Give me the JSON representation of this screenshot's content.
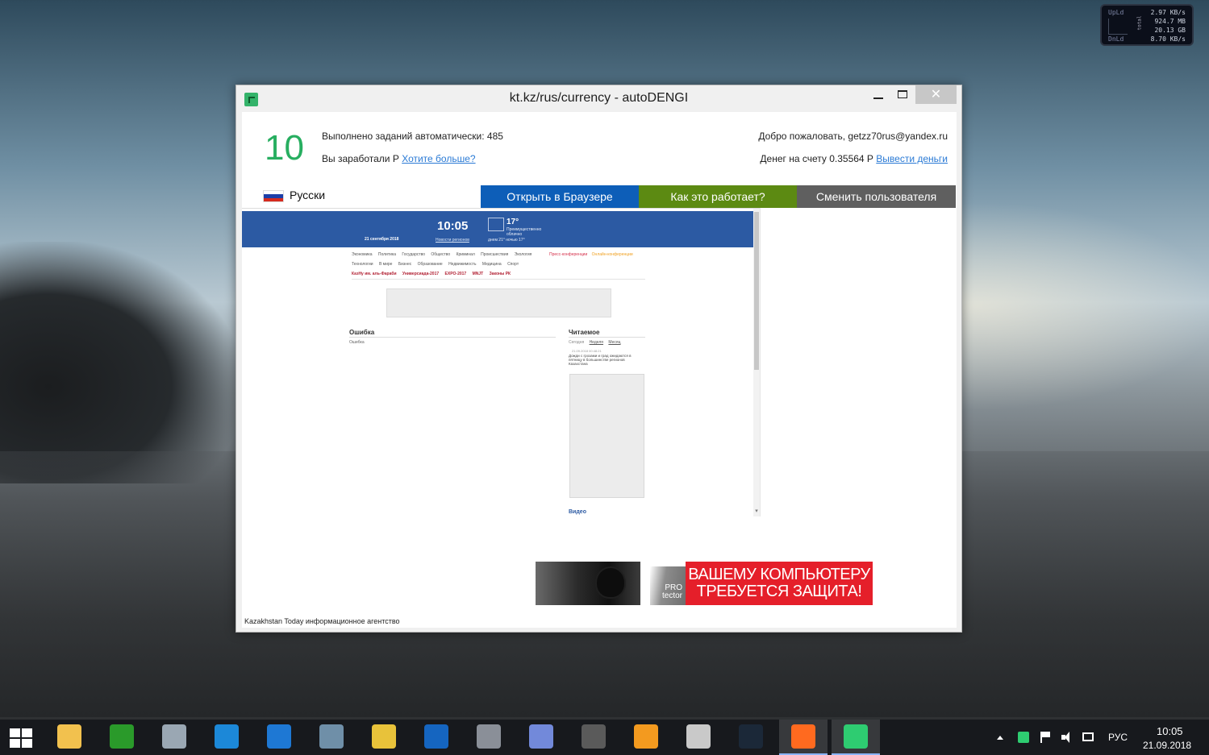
{
  "network_meter": {
    "upload_label": "UpLd",
    "download_label": "DnLd",
    "total_label": "total",
    "upload_rate": "2.97 KB/s",
    "total_upload": "924.7 MB",
    "total_download": "20.13 GB",
    "download_rate": "8.70 KB/s"
  },
  "window": {
    "title": "kt.kz/rus/currency - autoDENGI",
    "minimize": "—",
    "close": "✕"
  },
  "app": {
    "counter": "10",
    "tasks_done": "Выполнено заданий автоматически: 485",
    "earned_label": "Вы заработали  Р",
    "want_more_link": "Хотите больше?",
    "welcome": "Добро пожаловать, getzz70rus@yandex.ru",
    "balance_label": "Денег на счету 0.35564 Р",
    "withdraw_link": "Вывести деньги",
    "language": "Русски",
    "flag_colors": [
      "#ffffff",
      "#1c3fa8",
      "#d52b1e"
    ],
    "buttons": {
      "open_browser": "Открыть в Браузере",
      "how_it_works": "Как это работает?",
      "switch_user": "Сменить пользователя"
    },
    "button_colors": {
      "open_browser": "#0d5eb8",
      "how_it_works": "#5c8a12",
      "switch_user": "#5f5f5f"
    },
    "accent_color": "#27ae60",
    "footer": "Kazakhstan Today информационное агентство"
  },
  "site": {
    "time": "10:05",
    "date": "21 сентября 2018",
    "regional_news": "Новости регионов",
    "temperature": "17°",
    "weather_desc": "Преимущественно облачно",
    "day_night": "днем 21°   ночью 17°",
    "menu_row1": [
      "Экономика",
      "Политика",
      "Государство",
      "Общество",
      "Криминал",
      "Происшествия",
      "Экология"
    ],
    "menu_row2": [
      "Технологии",
      "В мире",
      "Бизнес",
      "Образование",
      "Недвижимость",
      "Медицина",
      "Спорт"
    ],
    "menu_red": [
      "КазНу им. аль-Фараби",
      "Универсиада-2017",
      "EXPO-2017",
      "MNJT",
      "Законы РК"
    ],
    "press_conf": "Пресс-конференции",
    "online_conf": "Онлайн-конференции",
    "error_title": "Ошибка",
    "error_text": "Ошибка",
    "read_title": "Читаемое",
    "read_tabs": [
      "Сегодня",
      "Неделя",
      "Месяц"
    ],
    "read_timestamp": "21.09.2018 00:48:21",
    "read_news": "Дожди с грозами и град ожидаются в пятницу в большинстве регионов Казахстана",
    "video_title": "Видео"
  },
  "ad": {
    "pro_text_1": "PRO",
    "pro_text_2": "tector",
    "headline_1": "ВАШЕМУ КОМПЬЮТЕРУ",
    "headline_2": "ТРЕБУЕТСЯ ЗАЩИТА!"
  },
  "taskbar": {
    "apps": [
      {
        "name": "file-explorer-icon",
        "color": "#f2c14e"
      },
      {
        "name": "mp3directcut-icon",
        "color": "#2a9a2a"
      },
      {
        "name": "notepad-pencil-icon",
        "color": "#9aa7b3"
      },
      {
        "name": "zona-icon",
        "color": "#1c88d8"
      },
      {
        "name": "internet-explorer-icon",
        "color": "#1e78d4"
      },
      {
        "name": "calculator-icon",
        "color": "#6f8fa8"
      },
      {
        "name": "paint-brushes-icon",
        "color": "#e8c23a"
      },
      {
        "name": "malwarebytes-icon",
        "color": "#1565c0"
      },
      {
        "name": "server-tool-icon",
        "color": "#8a8f98"
      },
      {
        "name": "discord-icon",
        "color": "#7289da"
      },
      {
        "name": "world-of-tanks-icon",
        "color": "#5a5a5a"
      },
      {
        "name": "avast-icon",
        "color": "#f39a1f"
      },
      {
        "name": "bolt-app-icon",
        "color": "#c9c9c9"
      },
      {
        "name": "steam-icon",
        "color": "#1b2838"
      },
      {
        "name": "firefox-icon",
        "color": "#ff6a1f"
      },
      {
        "name": "autodengi-icon",
        "color": "#2ecc71"
      }
    ],
    "language": "РУС",
    "time": "10:05",
    "date": "21.09.2018"
  }
}
